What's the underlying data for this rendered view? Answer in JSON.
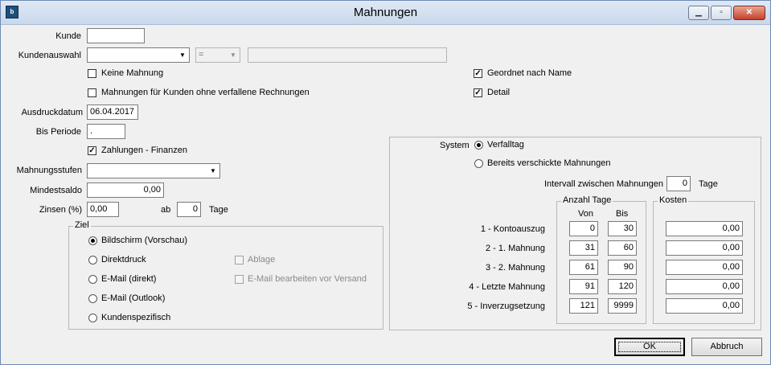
{
  "window": {
    "title": "Mahnungen",
    "app_icon": "app-logo-icon"
  },
  "form": {
    "kunde_label": "Kunde",
    "kunde_value": "",
    "kundenauswahl_label": "Kundenauswahl",
    "kundenauswahl_value": "",
    "operator_value": "=",
    "kundenauswahl_text": "",
    "keine_mahnung_label": "Keine Mahnung",
    "keine_mahnung_checked": false,
    "ohne_verfallene_label": "Mahnungen für Kunden ohne verfallene Rechnungen",
    "ohne_verfallene_checked": false,
    "geordnet_label": "Geordnet nach Name",
    "geordnet_checked": true,
    "detail_label": "Detail",
    "detail_checked": true,
    "ausdruckdatum_label": "Ausdruckdatum",
    "ausdruckdatum_value": "06.04.2017",
    "bis_periode_label": "Bis Periode",
    "bis_periode_value": ".",
    "zahlungen_label": "Zahlungen - Finanzen",
    "zahlungen_checked": true,
    "mahnungsstufen_label": "Mahnungsstufen",
    "mahnungsstufen_value": "",
    "mindestsaldo_label": "Mindestsaldo",
    "mindestsaldo_value": "0,00",
    "zinsen_label": "Zinsen (%)",
    "zinsen_value": "0,00",
    "ab_label": "ab",
    "ab_value": "0",
    "tage_label": "Tage"
  },
  "ziel": {
    "title": "Ziel",
    "options": [
      {
        "label": "Bildschirm (Vorschau)",
        "selected": true
      },
      {
        "label": "Direktdruck",
        "selected": false
      },
      {
        "label": "E-Mail (direkt)",
        "selected": false
      },
      {
        "label": "E-Mail (Outlook)",
        "selected": false
      },
      {
        "label": "Kundenspezifisch",
        "selected": false
      }
    ],
    "ablage_label": "Ablage",
    "email_bearbeiten_label": "E-Mail bearbeiten vor Versand"
  },
  "system": {
    "label": "System",
    "verfalltag_label": "Verfalltag",
    "bereits_label": "Bereits verschickte Mahnungen",
    "intervall_label": "Intervall zwischen Mahnungen",
    "intervall_value": "0",
    "intervall_unit": "Tage",
    "anzahl_tage_title": "Anzahl Tage",
    "von_label": "Von",
    "bis_label": "Bis",
    "kosten_title": "Kosten",
    "rows": [
      {
        "label": "1 - Kontoauszug",
        "von": "0",
        "bis": "30",
        "kosten": "0,00"
      },
      {
        "label": "2 - 1. Mahnung",
        "von": "31",
        "bis": "60",
        "kosten": "0,00"
      },
      {
        "label": "3 - 2. Mahnung",
        "von": "61",
        "bis": "90",
        "kosten": "0,00"
      },
      {
        "label": "4 - Letzte Mahnung",
        "von": "91",
        "bis": "120",
        "kosten": "0,00"
      },
      {
        "label": "5 - Inverzugsetzung",
        "von": "121",
        "bis": "9999",
        "kosten": "0,00"
      }
    ]
  },
  "buttons": {
    "ok": "OK",
    "abbruch": "Abbruch"
  }
}
